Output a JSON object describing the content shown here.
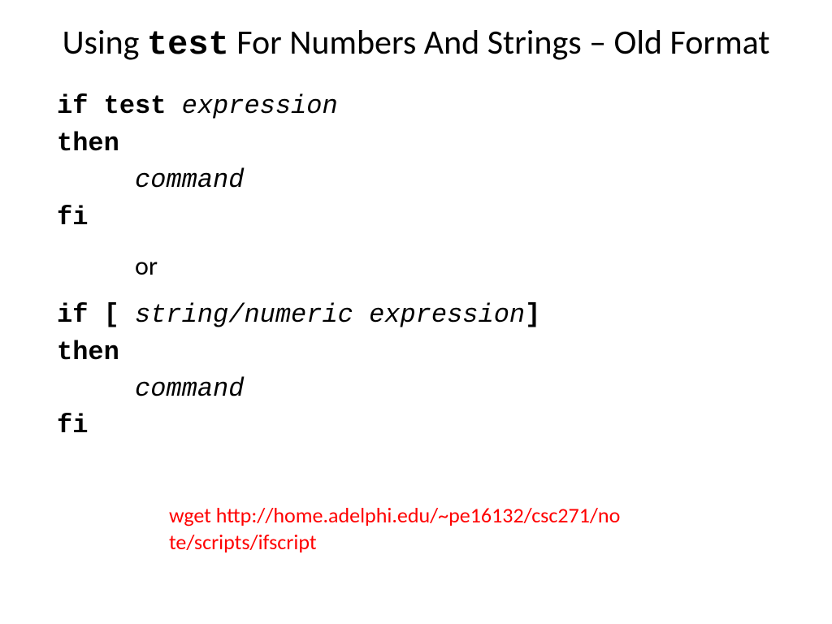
{
  "title": {
    "part1": "Using ",
    "mono": "test",
    "part2": " For Numbers And Strings – Old Format"
  },
  "code1": {
    "l1a": "if test ",
    "l1b": "expression",
    "l2": "then",
    "l3": "     command",
    "l4": "fi"
  },
  "or_label": "or",
  "code2": {
    "l1a": "if [ ",
    "l1b": "string/numeric expression",
    "l1c": "]",
    "l2": "then",
    "l3": "     command",
    "l4": "fi"
  },
  "note_text": "wget http://home.adelphi.edu/~pe16132/csc271/note/scripts/ifscript"
}
